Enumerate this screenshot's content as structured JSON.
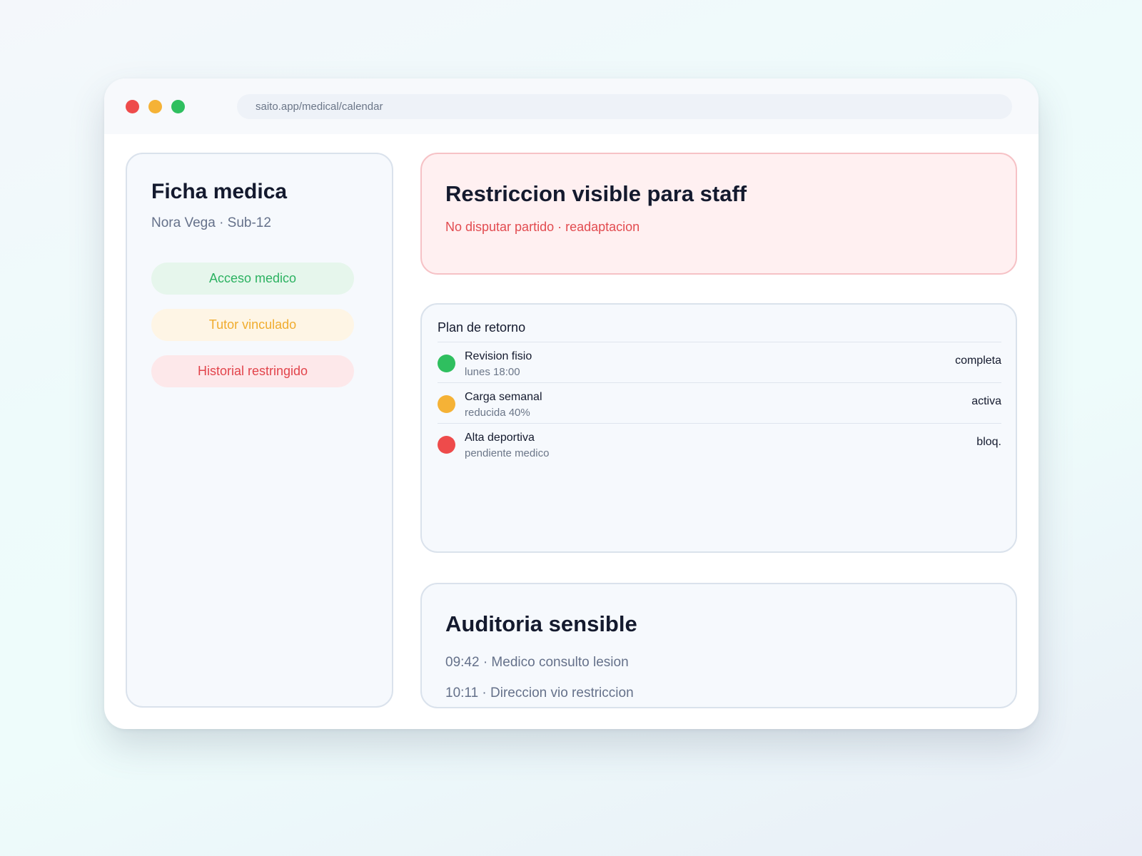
{
  "browser": {
    "url": "saito.app/medical/calendar"
  },
  "sidebar": {
    "title": "Ficha medica",
    "subtitle": "Nora Vega · Sub-12",
    "pills": [
      {
        "label": "Acceso medico",
        "color": "#2cb261"
      },
      {
        "label": "Tutor vinculado",
        "color": "#f0ac2e"
      },
      {
        "label": "Historial restringido",
        "color": "#e2444b"
      }
    ]
  },
  "restriction": {
    "title": "Restriccion visible para staff",
    "detail": "No disputar partido · readaptacion"
  },
  "plan": {
    "title": "Plan de retorno",
    "items": [
      {
        "name": "Revision fisio",
        "sub": "lunes 18:00",
        "state": "completa",
        "color": "#2fbf5f"
      },
      {
        "name": "Carga semanal",
        "sub": "reducida 40%",
        "state": "activa",
        "color": "#f5b236"
      },
      {
        "name": "Alta deportiva",
        "sub": "pendiente medico",
        "state": "bloq.",
        "color": "#ee4b4b"
      }
    ]
  },
  "audit": {
    "title": "Auditoria sensible",
    "entries": [
      "09:42 · Medico consulto lesion",
      "10:11 · Direccion vio restriccion"
    ]
  }
}
